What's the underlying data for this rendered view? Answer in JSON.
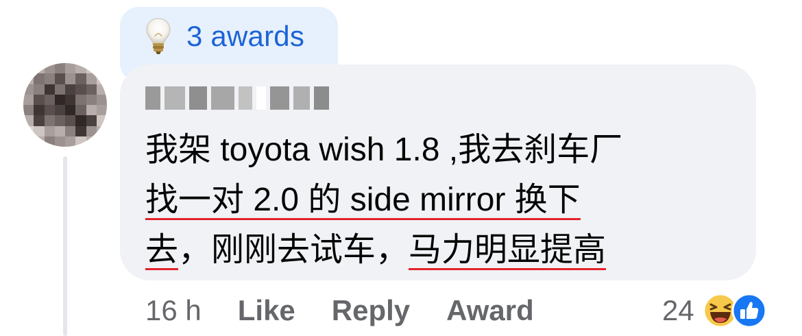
{
  "awards": {
    "icon": "lightbulb-icon",
    "label": "3 awards",
    "color": "#1b64d6"
  },
  "comment": {
    "author_name_blurred": true,
    "lines": [
      [
        {
          "text": "我架 toyota wish 1.8 ,我去刹车厂",
          "underline": false
        }
      ],
      [
        {
          "text": "找一对 2.0 的 side mirror 换下",
          "underline": true
        }
      ],
      [
        {
          "text": "去",
          "underline": true
        },
        {
          "text": "，刚刚去试车，",
          "underline": false
        },
        {
          "text": "马力明显提高",
          "underline": true
        }
      ]
    ],
    "underline_color": "#e3222b"
  },
  "actions": {
    "time": "16 h",
    "like_label": "Like",
    "reply_label": "Reply",
    "award_label": "Award"
  },
  "reactions": {
    "count": "24",
    "icons": [
      "haha-icon",
      "like-icon"
    ]
  },
  "colors": {
    "bubble_bg": "#f0f2f5",
    "award_bg": "#e7f0fd",
    "secondary_text": "#65676b",
    "like_blue": "#1877f2"
  }
}
